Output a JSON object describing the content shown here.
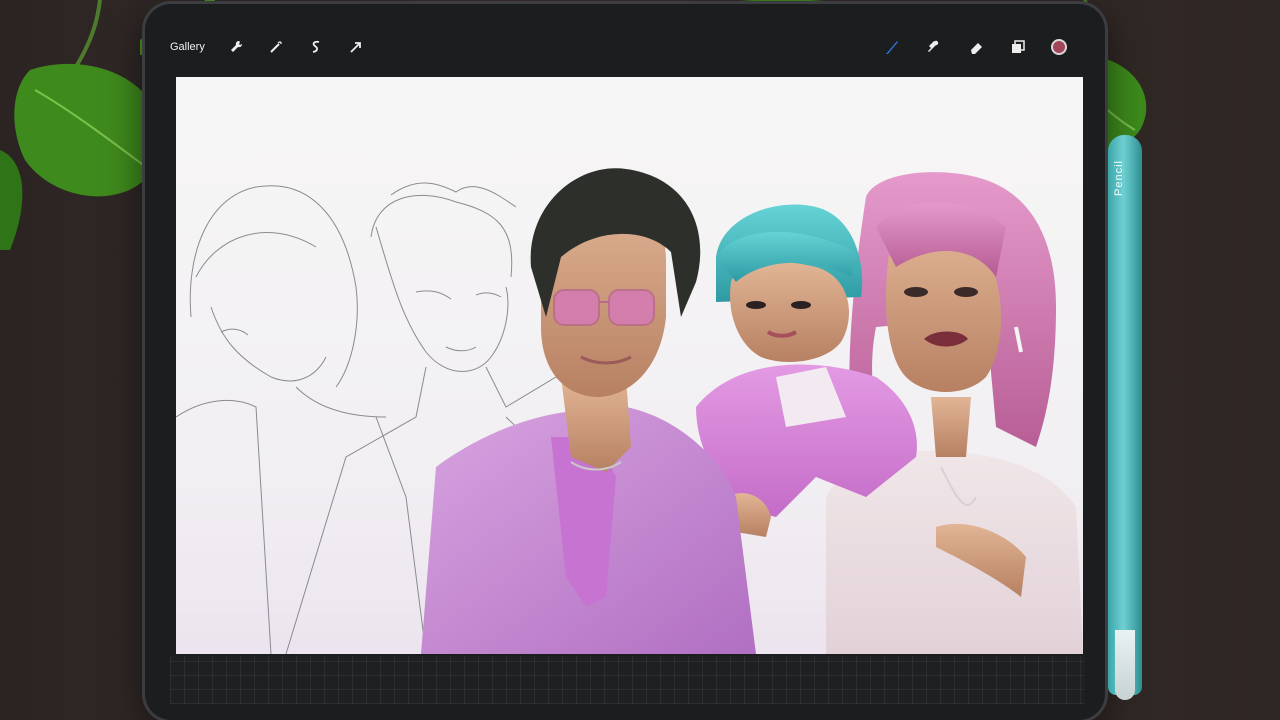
{
  "toolbar": {
    "gallery_label": "Gallery",
    "left_icons": [
      "wrench-icon",
      "magic-wand-icon",
      "selection-icon",
      "transform-arrow-icon"
    ],
    "right_icons": [
      "brush-icon",
      "smudge-icon",
      "eraser-icon",
      "layers-icon"
    ],
    "current_color": "#a0455a"
  },
  "pencil": {
    "brand_label": " Pencil",
    "color": "#4cbcbf"
  },
  "canvas": {
    "background": "#f4f2f4",
    "palette": {
      "shirt_pink": "#c58ad0",
      "hair_teal": "#4fc3c9",
      "hair_pink": "#d57fb0",
      "hair_dark": "#2d2f2a",
      "skin": "#d6a584"
    }
  }
}
